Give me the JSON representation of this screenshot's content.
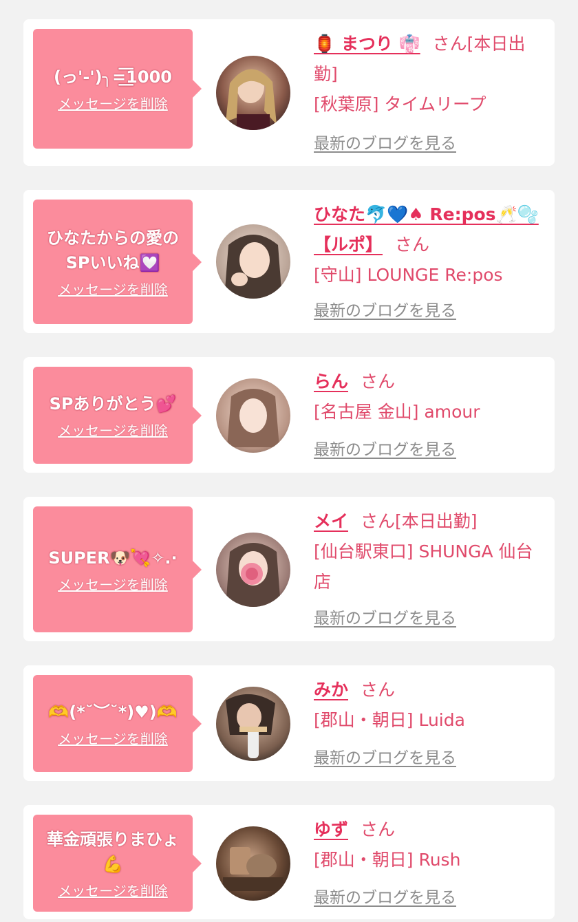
{
  "colors": {
    "page_bg": "#f2f2f2",
    "card_bg": "#ffffff",
    "bubble_bg": "#fb8c9c",
    "name_pink": "#e5305b",
    "text_pink": "#e04a6b",
    "link_gray": "#8c8c8c"
  },
  "messages": [
    {
      "text": "(っ'-')╮=͟͟͞͞1000",
      "delete_label": "メッセージを削除",
      "name": "🏮 まつり 👘",
      "suffix": "さん[本日出勤]",
      "shop": "[秋葉原] タイムリープ",
      "blog_label": "最新のブログを見る"
    },
    {
      "text": "ひなたからの愛の\nSPいいね💟",
      "delete_label": "メッセージを削除",
      "name": "ひなた🐬💙♠ Re:pos🥂🫧【ルポ】",
      "suffix": "さん",
      "shop": "[守山] LOUNGE Re:pos",
      "blog_label": "最新のブログを見る"
    },
    {
      "text": "SPありがとう💕",
      "delete_label": "メッセージを削除",
      "name": "らん",
      "suffix": "さん",
      "shop": "[名古屋 金山] amour",
      "blog_label": "最新のブログを見る"
    },
    {
      "text": "SUPER🐶💘✧.·",
      "delete_label": "メッセージを削除",
      "name": "メイ",
      "suffix": "さん[本日出勤]",
      "shop": "[仙台駅東口] SHUNGA 仙台店",
      "blog_label": "最新のブログを見る"
    },
    {
      "text": "🫶(*˘︶˘*)♥)🫶",
      "delete_label": "メッセージを削除",
      "name": "みか",
      "suffix": "さん",
      "shop": "[郡山・朝日] Luida",
      "blog_label": "最新のブログを見る"
    },
    {
      "text": "華金頑張りまひょ\n💪",
      "delete_label": "メッセージを削除",
      "name": "ゆず",
      "suffix": "さん",
      "shop": "[郡山・朝日] Rush",
      "blog_label": "最新のブログを見る"
    }
  ]
}
